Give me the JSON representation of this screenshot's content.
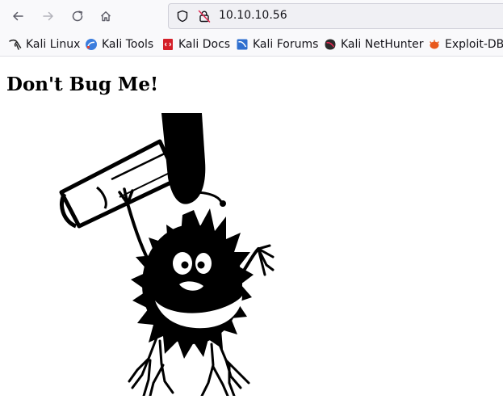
{
  "browser": {
    "url": "10.10.10.56",
    "nav": {
      "back_icon": "arrow-left-icon",
      "forward_icon": "arrow-right-icon",
      "reload_icon": "reload-icon",
      "home_icon": "home-icon"
    }
  },
  "bookmarks": [
    {
      "label": "Kali Linux",
      "icon": "kali-dragon-icon"
    },
    {
      "label": "Kali Tools",
      "icon": "kali-tools-icon"
    },
    {
      "label": "Kali Docs",
      "icon": "kali-docs-icon"
    },
    {
      "label": "Kali Forums",
      "icon": "kali-forums-icon"
    },
    {
      "label": "Kali NetHunter",
      "icon": "nethunter-icon"
    },
    {
      "label": "Exploit-DB",
      "icon": "exploit-db-icon"
    }
  ],
  "page": {
    "heading": "Don't Bug Me!",
    "image_subject": "cartoon bug hit by rolled newspaper"
  },
  "colors": {
    "toolbar_bg": "#f9f9fb",
    "urlbar_bg": "#f0f0f4",
    "kali_tools_blue": "#3b7ddd",
    "docs_red": "#d42029",
    "forums_blue": "#2f6fcf",
    "exploit_orange": "#e8591d"
  }
}
